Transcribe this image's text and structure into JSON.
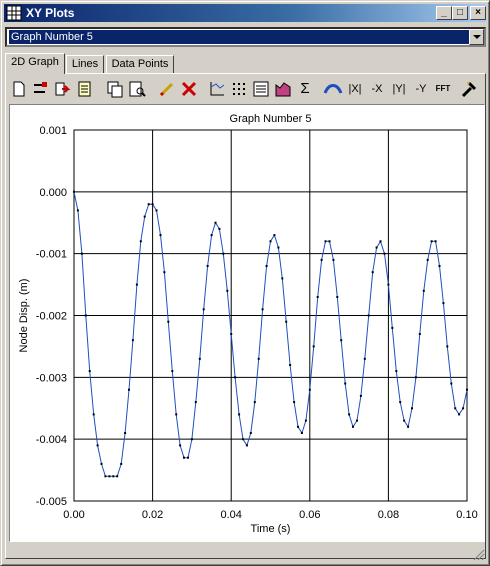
{
  "window": {
    "title": "XY Plots"
  },
  "graph_selector": {
    "value": "Graph Number 5"
  },
  "tabs": [
    {
      "label": "2D Graph",
      "active": true
    },
    {
      "label": "Lines",
      "active": false
    },
    {
      "label": "Data Points",
      "active": false
    }
  ],
  "toolbar": {
    "icons": [
      "new-page-icon",
      "add-line-icon",
      "export-icon",
      "properties-icon",
      "copy-icon",
      "print-preview-icon",
      "edit-pencil-icon",
      "delete-x-icon",
      "axes-icon",
      "grid-icon",
      "list-icon",
      "fill-icon",
      "sum-icon",
      "smooth-icon",
      "abs-x-icon",
      "neg-x-icon",
      "abs-y-icon",
      "neg-y-icon",
      "fft-icon",
      "tools-icon"
    ],
    "labels": {
      "sum": "Σ",
      "abs_x": "|X|",
      "neg_x": "-X",
      "abs_y": "|Y|",
      "neg_y": "-Y",
      "fft": "FFT"
    }
  },
  "chart_data": {
    "type": "line",
    "title": "Graph Number 5",
    "xlabel": "Time (s)",
    "ylabel": "Node Disp. (m)",
    "xlim": [
      0,
      0.1
    ],
    "ylim": [
      -0.005,
      0.001
    ],
    "x_ticks": [
      "0.00",
      "0.02",
      "0.04",
      "0.06",
      "0.08",
      "0.10"
    ],
    "y_ticks": [
      "0.001",
      "0.000",
      "-0.001",
      "-0.002",
      "-0.003",
      "-0.004",
      "-0.005"
    ],
    "grid": true,
    "line_color": "#1f4fbf",
    "marker_color": "#000000",
    "series": [
      {
        "x": [
          0.0,
          0.001,
          0.002,
          0.003,
          0.004,
          0.005,
          0.006,
          0.007,
          0.008,
          0.009,
          0.01,
          0.011,
          0.012,
          0.013,
          0.014,
          0.015,
          0.016,
          0.017,
          0.018,
          0.019,
          0.02,
          0.021,
          0.022,
          0.023,
          0.024,
          0.025,
          0.026,
          0.027,
          0.028,
          0.029,
          0.03,
          0.031,
          0.032,
          0.033,
          0.034,
          0.035,
          0.036,
          0.037,
          0.038,
          0.039,
          0.04,
          0.041,
          0.042,
          0.043,
          0.044,
          0.045,
          0.046,
          0.047,
          0.048,
          0.049,
          0.05,
          0.051,
          0.052,
          0.053,
          0.054,
          0.055,
          0.056,
          0.057,
          0.058,
          0.059,
          0.06,
          0.061,
          0.062,
          0.063,
          0.064,
          0.065,
          0.066,
          0.067,
          0.068,
          0.069,
          0.07,
          0.071,
          0.072,
          0.073,
          0.074,
          0.075,
          0.076,
          0.077,
          0.078,
          0.079,
          0.08,
          0.081,
          0.082,
          0.083,
          0.084,
          0.085,
          0.086,
          0.087,
          0.088,
          0.089,
          0.09,
          0.091,
          0.092,
          0.093,
          0.094,
          0.095,
          0.096,
          0.097,
          0.098,
          0.099,
          0.1
        ],
        "y": [
          0.0,
          -0.0003,
          -0.001,
          -0.002,
          -0.0029,
          -0.0036,
          -0.0041,
          -0.0044,
          -0.0046,
          -0.0046,
          -0.0046,
          -0.0046,
          -0.0044,
          -0.0039,
          -0.0032,
          -0.0024,
          -0.0015,
          -0.0008,
          -0.0004,
          -0.0002,
          -0.0002,
          -0.0003,
          -0.0007,
          -0.0013,
          -0.0021,
          -0.0029,
          -0.0036,
          -0.0041,
          -0.0043,
          -0.0043,
          -0.004,
          -0.0034,
          -0.0027,
          -0.0019,
          -0.0012,
          -0.0007,
          -0.0005,
          -0.0006,
          -0.001,
          -0.0016,
          -0.0023,
          -0.003,
          -0.0036,
          -0.004,
          -0.0041,
          -0.0039,
          -0.0034,
          -0.0027,
          -0.0019,
          -0.0012,
          -0.0008,
          -0.0007,
          -0.0009,
          -0.0014,
          -0.0021,
          -0.0028,
          -0.0034,
          -0.0038,
          -0.0039,
          -0.0037,
          -0.0032,
          -0.0025,
          -0.0017,
          -0.0011,
          -0.0008,
          -0.0008,
          -0.0011,
          -0.0017,
          -0.0024,
          -0.0031,
          -0.0036,
          -0.0038,
          -0.0037,
          -0.0033,
          -0.0027,
          -0.002,
          -0.0013,
          -0.0009,
          -0.0008,
          -0.001,
          -0.0015,
          -0.0022,
          -0.0029,
          -0.0034,
          -0.0037,
          -0.0038,
          -0.0035,
          -0.003,
          -0.0023,
          -0.0016,
          -0.0011,
          -0.0008,
          -0.0008,
          -0.0012,
          -0.0018,
          -0.0025,
          -0.0031,
          -0.0035,
          -0.0036,
          -0.0035,
          -0.0032
        ]
      }
    ]
  }
}
